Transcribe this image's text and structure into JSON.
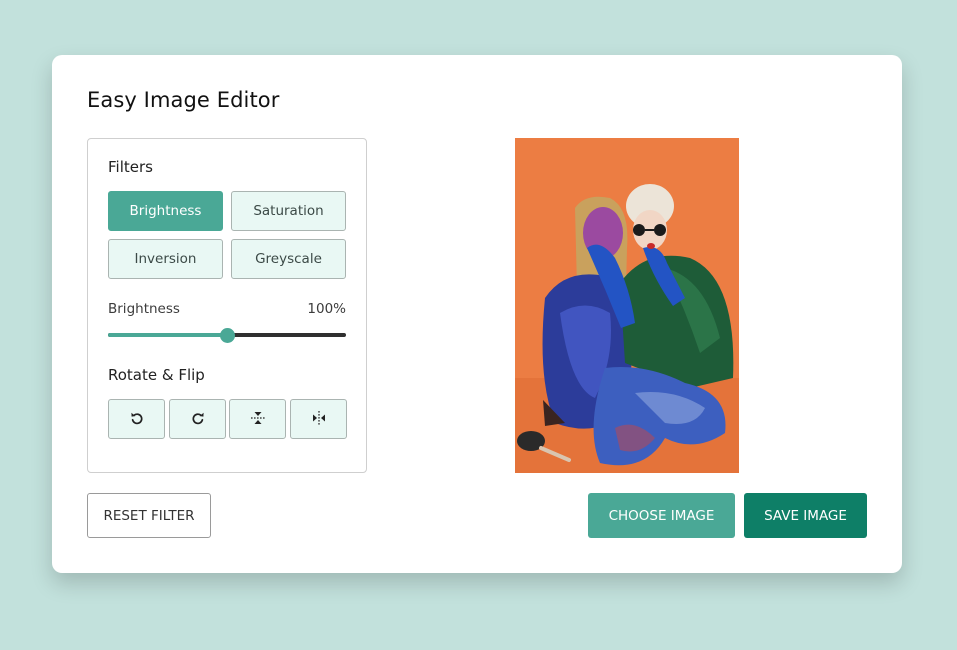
{
  "app": {
    "title": "Easy Image Editor"
  },
  "filters": {
    "title": "Filters",
    "buttons": [
      {
        "label": "Brightness",
        "active": true
      },
      {
        "label": "Saturation",
        "active": false
      },
      {
        "label": "Inversion",
        "active": false
      },
      {
        "label": "Greyscale",
        "active": false
      }
    ],
    "slider": {
      "label": "Brightness",
      "value_text": "100%",
      "value": 100,
      "max": 200
    }
  },
  "rotate": {
    "title": "Rotate & Flip",
    "buttons": [
      {
        "icon": "rotate-left-icon"
      },
      {
        "icon": "rotate-right-icon"
      },
      {
        "icon": "flip-vertical-icon"
      },
      {
        "icon": "flip-horizontal-icon"
      }
    ]
  },
  "actions": {
    "reset_label": "Reset Filter",
    "choose_label": "Choose Image",
    "save_label": "Save Image"
  },
  "colors": {
    "background": "#c2e1dc",
    "accent": "#4aa896",
    "accent_dark": "#0e7f67",
    "button_light": "#e9f8f4",
    "photo_background": "#ec7d43"
  }
}
